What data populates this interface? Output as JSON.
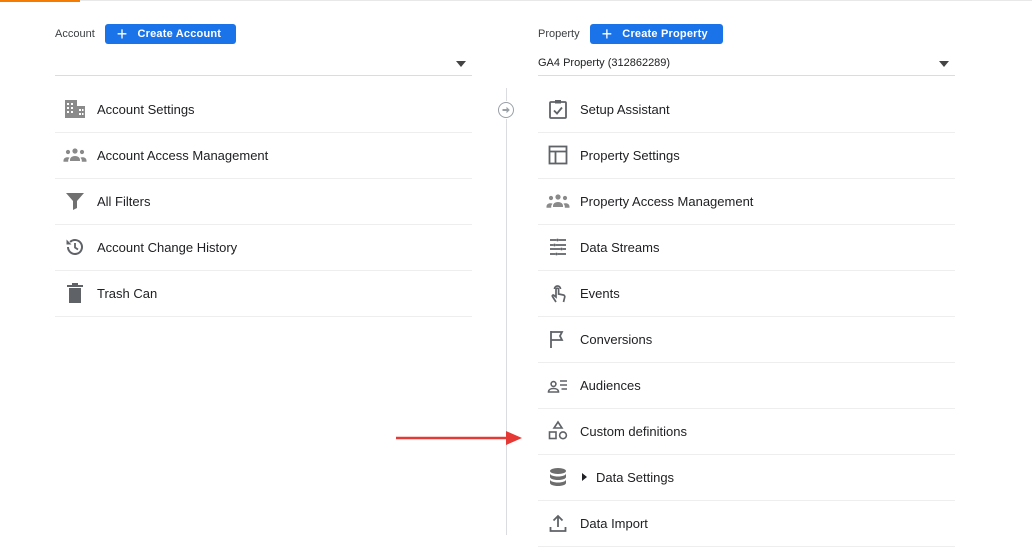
{
  "account": {
    "label": "Account",
    "create_button": "Create Account",
    "selected": "",
    "items": [
      {
        "label": "Account Settings",
        "icon": "building-icon"
      },
      {
        "label": "Account Access Management",
        "icon": "people-icon"
      },
      {
        "label": "All Filters",
        "icon": "filter-icon"
      },
      {
        "label": "Account Change History",
        "icon": "history-icon"
      },
      {
        "label": "Trash Can",
        "icon": "trash-icon"
      }
    ]
  },
  "property": {
    "label": "Property",
    "create_button": "Create Property",
    "selected": "GA4 Property (312862289)",
    "items": [
      {
        "label": "Setup Assistant",
        "icon": "checkbox-icon"
      },
      {
        "label": "Property Settings",
        "icon": "layout-icon"
      },
      {
        "label": "Property Access Management",
        "icon": "people-icon"
      },
      {
        "label": "Data Streams",
        "icon": "streams-icon"
      },
      {
        "label": "Events",
        "icon": "touch-icon"
      },
      {
        "label": "Conversions",
        "icon": "flag-icon"
      },
      {
        "label": "Audiences",
        "icon": "audience-icon"
      },
      {
        "label": "Custom definitions",
        "icon": "shapes-icon"
      },
      {
        "label": "Data Settings",
        "icon": "database-icon"
      },
      {
        "label": "Data Import",
        "icon": "upload-icon"
      }
    ]
  },
  "colors": {
    "accent": "#1a73e8",
    "annotation_arrow": "#e53935",
    "top_accent": "#f57c00"
  }
}
